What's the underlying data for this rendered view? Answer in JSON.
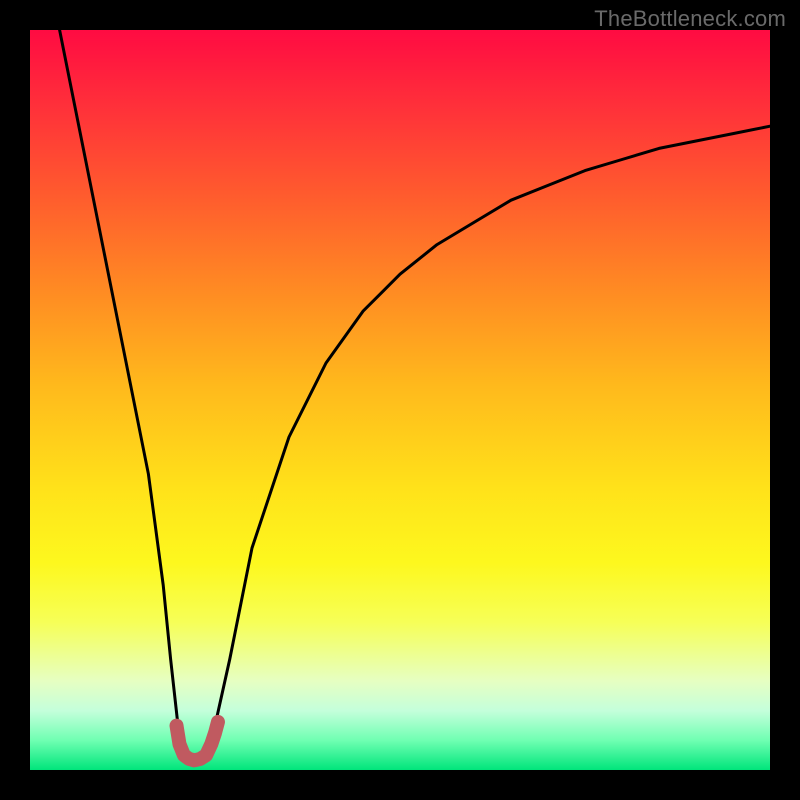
{
  "watermark": "TheBottleneck.com",
  "chart_data": {
    "type": "line",
    "title": "",
    "xlabel": "",
    "ylabel": "",
    "xlim": [
      0,
      100
    ],
    "ylim": [
      0,
      100
    ],
    "series": [
      {
        "name": "bottleneck-curve",
        "x": [
          4,
          6,
          8,
          10,
          12,
          14,
          16,
          18,
          19,
          20,
          21,
          22,
          23,
          24,
          25,
          27,
          30,
          35,
          40,
          45,
          50,
          55,
          60,
          65,
          70,
          75,
          80,
          85,
          90,
          95,
          100
        ],
        "values": [
          100,
          90,
          80,
          70,
          60,
          50,
          40,
          25,
          15,
          6,
          2,
          1,
          1,
          2,
          6,
          15,
          30,
          45,
          55,
          62,
          67,
          71,
          74,
          77,
          79,
          81,
          82.5,
          84,
          85,
          86,
          87
        ]
      },
      {
        "name": "minimum-marker",
        "x": [
          19.8,
          20.2,
          20.8,
          21.5,
          22.2,
          23.0,
          23.8,
          24.5,
          25.0,
          25.4
        ],
        "values": [
          6.0,
          3.5,
          2.0,
          1.5,
          1.3,
          1.5,
          2.0,
          3.5,
          5.0,
          6.5
        ]
      }
    ],
    "colors": {
      "curve": "#000000",
      "marker": "#c05a60",
      "gradient_top": "#ff0b42",
      "gradient_bottom": "#00e57b"
    }
  }
}
